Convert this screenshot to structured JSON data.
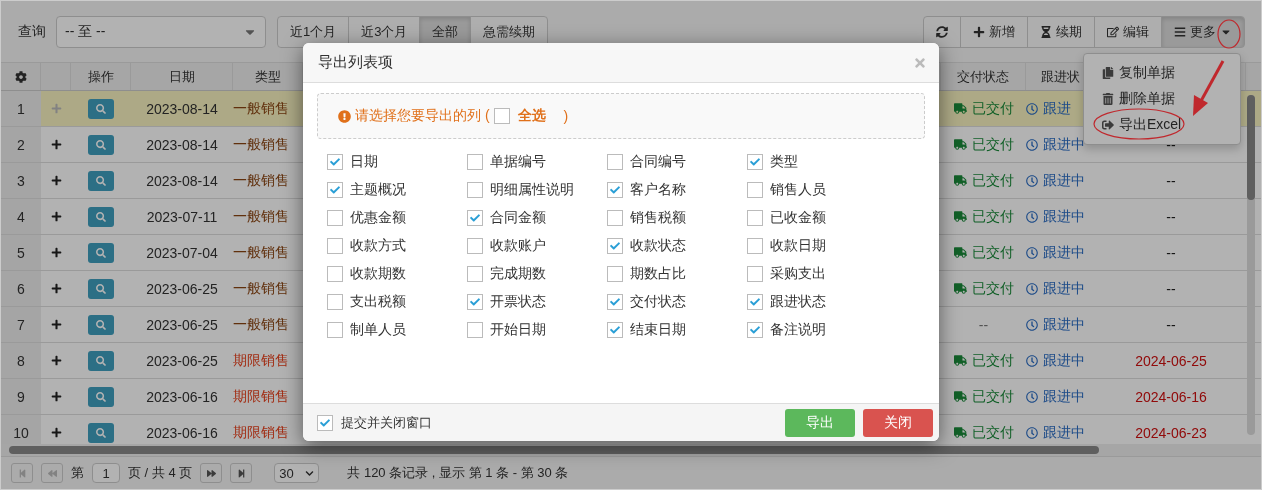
{
  "toolbar": {
    "query_label": "查询",
    "date_range": {
      "value": "-- 至 --"
    },
    "filters": [
      {
        "label": "近1个月",
        "selected": false
      },
      {
        "label": "近3个月",
        "selected": false
      },
      {
        "label": "全部",
        "selected": true
      },
      {
        "label": "急需续期",
        "selected": false
      }
    ],
    "actions": [
      {
        "kind": "refresh",
        "expanded": false
      },
      {
        "kind": "add",
        "label": "新增",
        "expanded": false
      },
      {
        "kind": "renew",
        "label": "续期",
        "expanded": false
      },
      {
        "kind": "edit",
        "label": "编辑",
        "expanded": false
      },
      {
        "kind": "more",
        "label": "更多",
        "expanded": true
      }
    ]
  },
  "more_menu": {
    "items": [
      {
        "kind": "copy",
        "label": "复制单据"
      },
      {
        "kind": "delete",
        "label": "删除单据"
      },
      {
        "kind": "export",
        "label": "导出Excel"
      }
    ]
  },
  "table": {
    "columns": [
      "操作",
      "日期",
      "类型",
      "交付状态",
      "跟进状"
    ],
    "rows": [
      {
        "index": "1",
        "highlighted": true,
        "expand_disabled": true,
        "date": "2023-08-14",
        "type": {
          "label": "一般销售",
          "kind": "general"
        },
        "delivery": {
          "label": "已交付",
          "delivered": true
        },
        "follow_up": "跟进"
      },
      {
        "index": "2",
        "highlighted": false,
        "expand_disabled": false,
        "date": "2023-08-14",
        "type": {
          "label": "一般销售",
          "kind": "general"
        },
        "delivery": {
          "label": "已交付",
          "delivered": true
        },
        "follow_up": "跟进中",
        "column_7": {
          "text": "--",
          "alert": false
        }
      },
      {
        "index": "3",
        "highlighted": false,
        "expand_disabled": false,
        "date": "2023-08-14",
        "type": {
          "label": "一般销售",
          "kind": "general"
        },
        "delivery": {
          "label": "已交付",
          "delivered": true
        },
        "follow_up": "跟进中",
        "column_7": {
          "text": "--",
          "alert": false
        }
      },
      {
        "index": "4",
        "highlighted": false,
        "expand_disabled": false,
        "date": "2023-07-11",
        "type": {
          "label": "一般销售",
          "kind": "general"
        },
        "delivery": {
          "label": "已交付",
          "delivered": true
        },
        "follow_up": "跟进中",
        "column_7": {
          "text": "--",
          "alert": false
        }
      },
      {
        "index": "5",
        "highlighted": false,
        "expand_disabled": false,
        "date": "2023-07-04",
        "type": {
          "label": "一般销售",
          "kind": "general"
        },
        "delivery": {
          "label": "已交付",
          "delivered": true
        },
        "follow_up": "跟进中",
        "column_7": {
          "text": "--",
          "alert": false
        }
      },
      {
        "index": "6",
        "highlighted": false,
        "expand_disabled": false,
        "date": "2023-06-25",
        "type": {
          "label": "一般销售",
          "kind": "general"
        },
        "delivery": {
          "label": "已交付",
          "delivered": true
        },
        "follow_up": "跟进中",
        "column_7": {
          "text": "--",
          "alert": false
        }
      },
      {
        "index": "7",
        "highlighted": false,
        "expand_disabled": false,
        "date": "2023-06-25",
        "type": {
          "label": "一般销售",
          "kind": "general"
        },
        "delivery": {
          "label": "--",
          "delivered": false
        },
        "follow_up": "跟进中",
        "column_7": {
          "text": "--",
          "alert": false
        }
      },
      {
        "index": "8",
        "highlighted": false,
        "expand_disabled": false,
        "date": "2023-06-25",
        "type": {
          "label": "期限销售",
          "kind": "term"
        },
        "delivery": {
          "label": "已交付",
          "delivered": true
        },
        "follow_up": "跟进中",
        "column_7": {
          "text": "2024-06-25",
          "alert": true
        }
      },
      {
        "index": "9",
        "highlighted": false,
        "expand_disabled": false,
        "date": "2023-06-16",
        "type": {
          "label": "期限销售",
          "kind": "term"
        },
        "delivery": {
          "label": "已交付",
          "delivered": true
        },
        "follow_up": "跟进中",
        "column_7": {
          "text": "2024-06-16",
          "alert": true
        }
      },
      {
        "index": "10",
        "highlighted": false,
        "expand_disabled": false,
        "date": "2023-06-16",
        "type": {
          "label": "期限销售",
          "kind": "term"
        },
        "delivery": {
          "label": "已交付",
          "delivered": true
        },
        "follow_up": "跟进中",
        "column_7": {
          "text": "2024-06-23",
          "alert": true
        }
      }
    ]
  },
  "pager": {
    "nav": [
      {
        "kind": "first",
        "disabled": true
      },
      {
        "kind": "prev",
        "disabled": true
      },
      {
        "kind": "next",
        "disabled": false
      },
      {
        "kind": "last",
        "disabled": false
      }
    ],
    "page_prefix": "第",
    "page": "1",
    "page_suffix": "页 / 共 4 页",
    "page_size": "30",
    "summary": "共 120 条记录 , 显示 第 1 条 - 第 30 条"
  },
  "dialog": {
    "title": "导出列表项",
    "notice": "请选择您要导出的列 (",
    "select_all": {
      "label": "全选",
      "checked": false
    },
    "notice_end": ")",
    "columns": [
      {
        "label": "日期",
        "checked": true
      },
      {
        "label": "单据编号",
        "checked": false
      },
      {
        "label": "合同编号",
        "checked": false
      },
      {
        "label": "类型",
        "checked": true
      },
      {
        "label": "主题概况",
        "checked": true
      },
      {
        "label": "明细属性说明",
        "checked": false
      },
      {
        "label": "客户名称",
        "checked": true
      },
      {
        "label": "销售人员",
        "checked": false
      },
      {
        "label": "优惠金额",
        "checked": false
      },
      {
        "label": "合同金额",
        "checked": true
      },
      {
        "label": "销售税额",
        "checked": false
      },
      {
        "label": "已收金额",
        "checked": false
      },
      {
        "label": "收款方式",
        "checked": false
      },
      {
        "label": "收款账户",
        "checked": false
      },
      {
        "label": "收款状态",
        "checked": true
      },
      {
        "label": "收款日期",
        "checked": false
      },
      {
        "label": "收款期数",
        "checked": false
      },
      {
        "label": "完成期数",
        "checked": false
      },
      {
        "label": "期数占比",
        "checked": false
      },
      {
        "label": "采购支出",
        "checked": false
      },
      {
        "label": "支出税额",
        "checked": false
      },
      {
        "label": "开票状态",
        "checked": true
      },
      {
        "label": "交付状态",
        "checked": true
      },
      {
        "label": "跟进状态",
        "checked": true
      },
      {
        "label": "制单人员",
        "checked": false
      },
      {
        "label": "开始日期",
        "checked": false
      },
      {
        "label": "结束日期",
        "checked": true
      },
      {
        "label": "备注说明",
        "checked": true
      }
    ],
    "close_on_submit": {
      "label": "提交并关闭窗口",
      "checked": true
    },
    "buttons": [
      {
        "kind": "primary",
        "label": "导出"
      },
      {
        "kind": "danger",
        "label": "关闭"
      }
    ]
  }
}
